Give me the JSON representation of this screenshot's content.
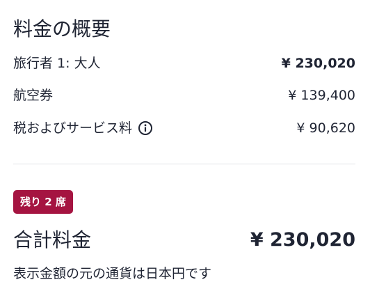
{
  "summary": {
    "title": "料金の概要",
    "traveler": {
      "label": "旅行者 1: 大人",
      "amount": "¥ 230,020"
    },
    "airfare": {
      "label": "航空券",
      "amount": "¥ 139,400"
    },
    "taxes": {
      "label": "税およびサービス料",
      "amount": "¥ 90,620",
      "icon": "info-icon"
    },
    "badge": "残り 2 席",
    "total": {
      "label": "合計料金",
      "amount": "¥ 230,020"
    },
    "currency_note": "表示金額の元の通貨は日本円です"
  },
  "colors": {
    "text": "#1f2433",
    "badge_bg": "#a51441",
    "divider": "#e1e3e8"
  }
}
